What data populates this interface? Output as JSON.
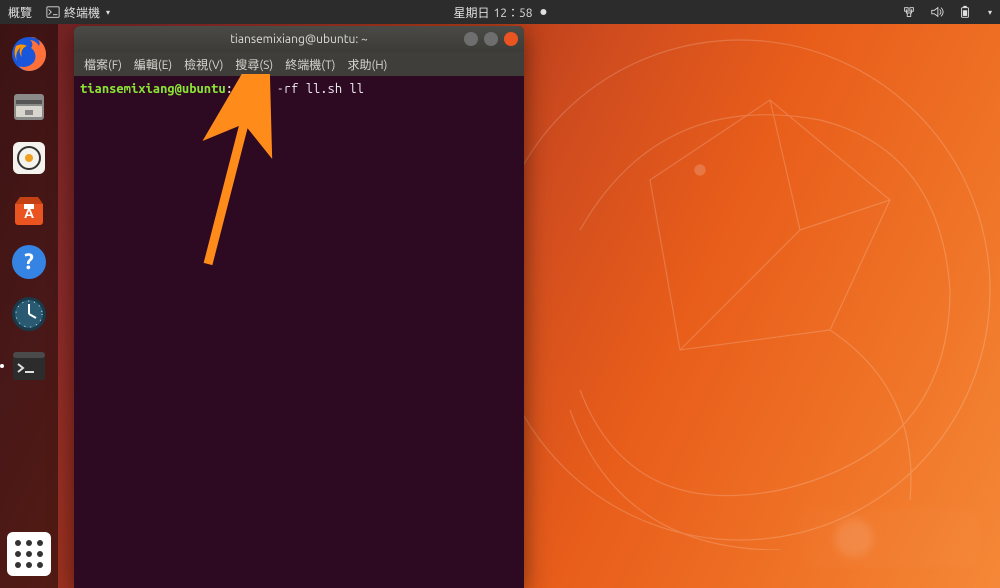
{
  "top_panel": {
    "activities": "概覽",
    "app_name": "終端機",
    "clock_day": "星期日",
    "clock_time": "12：58"
  },
  "dock": {
    "items": [
      {
        "name": "firefox"
      },
      {
        "name": "files"
      },
      {
        "name": "rhythmbox"
      },
      {
        "name": "software"
      },
      {
        "name": "help"
      },
      {
        "name": "clocks"
      },
      {
        "name": "terminal"
      }
    ]
  },
  "terminal": {
    "title": "tiansemixiang@ubuntu: ~",
    "menu": {
      "file": "檔案(F)",
      "edit": "編輯(E)",
      "view": "檢視(V)",
      "search": "搜尋(S)",
      "terminal": "終端機(T)",
      "help": "求助(H)"
    },
    "prompt": {
      "user_host": "tiansemixiang@ubuntu",
      "sep1": ":",
      "path": "~",
      "sep2": "$",
      "command": "rm -rf ll.sh ll"
    }
  }
}
